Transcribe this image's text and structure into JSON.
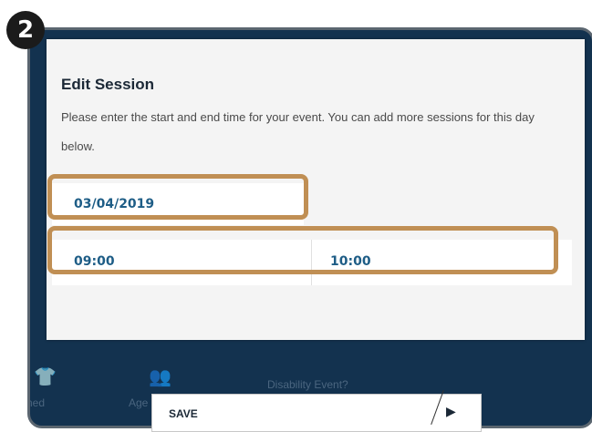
{
  "step": {
    "number": "2"
  },
  "modal": {
    "title": "Edit Session",
    "description": "Please enter the start and end time for your event. You can add more sessions for this day below.",
    "date": "03/04/2019",
    "start_time": "09:00",
    "end_time": "10:00"
  },
  "background": {
    "label_left": "ned",
    "label_age": "Age",
    "label_disability": "Disability Event?"
  },
  "footer": {
    "save_label": "SAVE",
    "next_icon": "chevron-right-icon"
  },
  "colors": {
    "app_background": "#13324f",
    "highlight": "#c08f54",
    "field_text": "#1e5d86"
  }
}
